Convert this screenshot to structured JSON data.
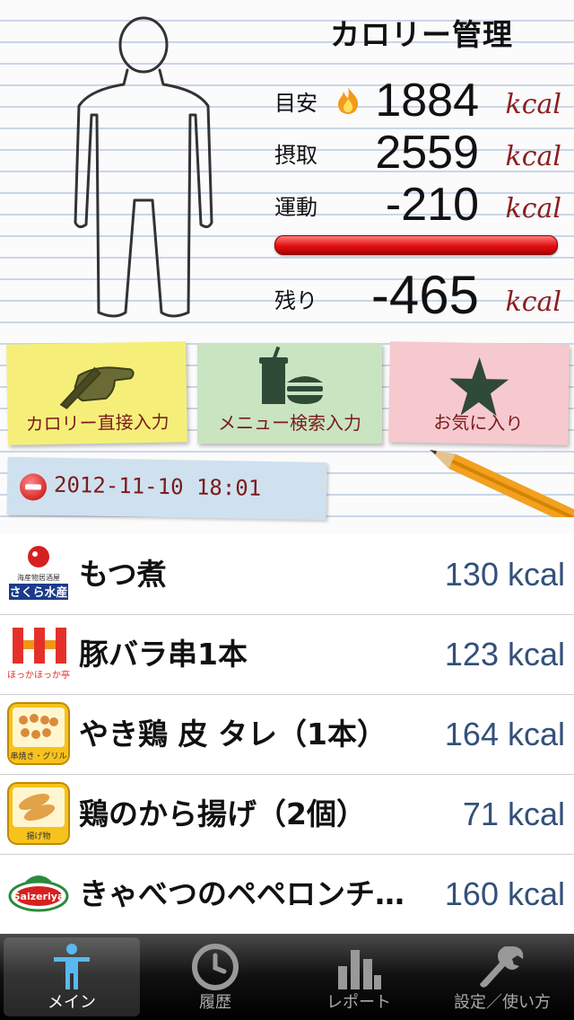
{
  "header": {
    "title": "カロリー管理",
    "target": {
      "label": "目安",
      "value": "1884",
      "unit": "kcal"
    },
    "intake": {
      "label": "摂取",
      "value": "2559",
      "unit": "kcal"
    },
    "exercise": {
      "label": "運動",
      "value": "-210",
      "unit": "kcal"
    },
    "remaining": {
      "label": "残り",
      "value": "-465",
      "unit": "kcal"
    }
  },
  "actions": {
    "direct": "カロリー直接入力",
    "menu": "メニュー検索入力",
    "favorite": "お気に入り"
  },
  "date": "2012-11-10 18:01",
  "items": [
    {
      "name": "もつ煮",
      "kcal": "130 kcal",
      "logo": "さくら水産",
      "logo_sub": "海産物居酒屋"
    },
    {
      "name": "豚バラ串1本",
      "kcal": "123 kcal",
      "logo": "ほっかほっか亭"
    },
    {
      "name": "やき鶏 皮 タレ（1本）",
      "kcal": "164 kcal",
      "logo": "串焼き・グリル"
    },
    {
      "name": "鶏のから揚げ（2個）",
      "kcal": "71 kcal",
      "logo": "揚げ物"
    },
    {
      "name": "きゃべつのペペロンチ…",
      "kcal": "160 kcal",
      "logo": "Saizeriya"
    }
  ],
  "tabs": [
    {
      "label": "メイン",
      "icon": "person-icon"
    },
    {
      "label": "履歴",
      "icon": "clock-icon"
    },
    {
      "label": "レポート",
      "icon": "bar-chart-icon"
    },
    {
      "label": "設定／使い方",
      "icon": "wrench-icon"
    }
  ],
  "colors": {
    "accent_red": "#8a1f1f",
    "kcal_blue": "#33507a",
    "bar_red": "#e01010"
  }
}
